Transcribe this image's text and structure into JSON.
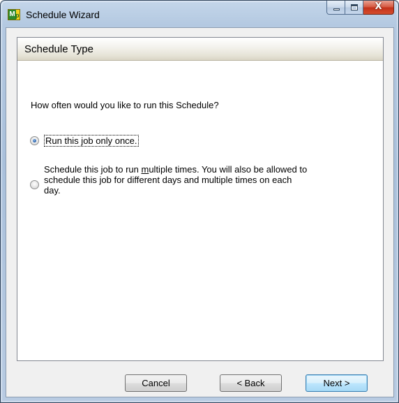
{
  "window": {
    "title": "Schedule Wizard",
    "app_icon": "mp-app-icon",
    "caption_buttons": {
      "minimize_icon": "minimize-icon",
      "maximize_icon": "maximize-icon",
      "close_glyph": "X"
    }
  },
  "page": {
    "header_title": "Schedule Type",
    "question": "How often would you like to run this Schedule?",
    "options": [
      {
        "label": "Run this job only once.",
        "checked": true
      },
      {
        "line1_pre": "Schedule this job to run ",
        "line1_u": "m",
        "line1_post": "ultiple times. You will also be allowed to",
        "line2": "schedule this job for different days and multiple times on each",
        "line3": "day.",
        "checked": false
      }
    ]
  },
  "buttons": {
    "cancel": "Cancel",
    "back": "< Back",
    "next": "Next >"
  },
  "colors": {
    "selected_radio": "#2f68b0",
    "default_button_border": "#3c7fb1"
  }
}
